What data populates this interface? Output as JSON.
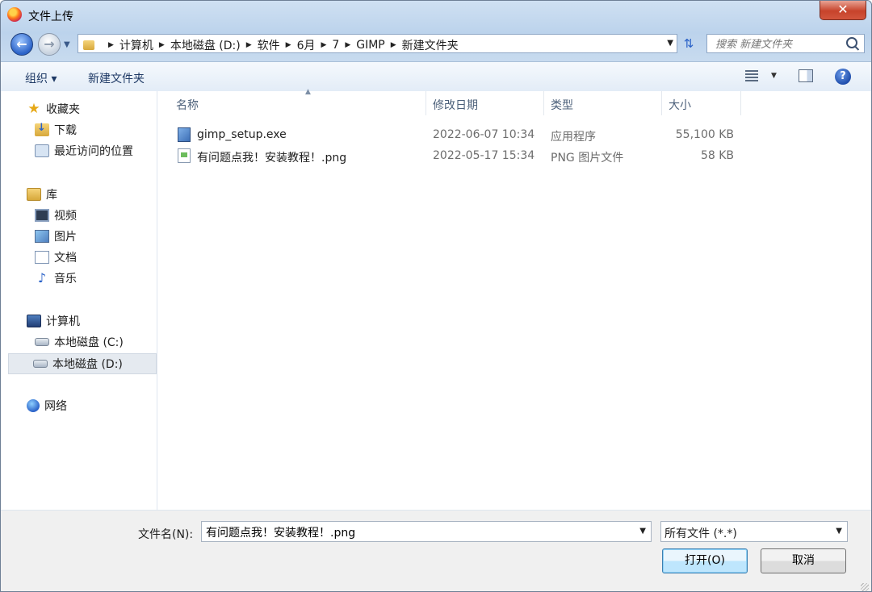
{
  "window": {
    "title": "文件上传",
    "close_label": "✕"
  },
  "nav": {
    "back_label": "←",
    "forward_label": "→",
    "breadcrumb": [
      "计算机",
      "本地磁盘 (D:)",
      "软件",
      "6月",
      "7",
      "GIMP",
      "新建文件夹"
    ],
    "search_placeholder": "搜索 新建文件夹"
  },
  "toolbar": {
    "organize_label": "组织 ▾",
    "new_folder_label": "新建文件夹",
    "help_label": "?"
  },
  "navpane": {
    "favorites": {
      "label": "收藏夹",
      "items": [
        "下载",
        "最近访问的位置"
      ]
    },
    "libraries": {
      "label": "库",
      "items": [
        "视频",
        "图片",
        "文档",
        "音乐"
      ]
    },
    "computer": {
      "label": "计算机",
      "items": [
        "本地磁盘 (C:)",
        "本地磁盘 (D:)"
      ],
      "selected": "本地磁盘 (D:)"
    },
    "network": {
      "label": "网络"
    }
  },
  "filelist": {
    "columns": [
      "名称",
      "修改日期",
      "类型",
      "大小"
    ],
    "rows": [
      {
        "name": "gimp_setup.exe",
        "date": "2022-06-07 10:34",
        "type": "应用程序",
        "size": "55,100 KB",
        "icon": "exe-icon"
      },
      {
        "name": "有问题点我！安装教程！.png",
        "date": "2022-05-17 15:34",
        "type": "PNG 图片文件",
        "size": "58 KB",
        "icon": "png-icon"
      }
    ]
  },
  "footer": {
    "filename_label": "文件名(N):",
    "filename_value": "有问题点我！安装教程！.png",
    "filter_value": "所有文件 (*.*)",
    "open_label": "打开(O)",
    "cancel_label": "取消"
  },
  "colors": {
    "accent": "#2a62c8",
    "close": "#c7432b",
    "selection": "#e5eaf0"
  }
}
